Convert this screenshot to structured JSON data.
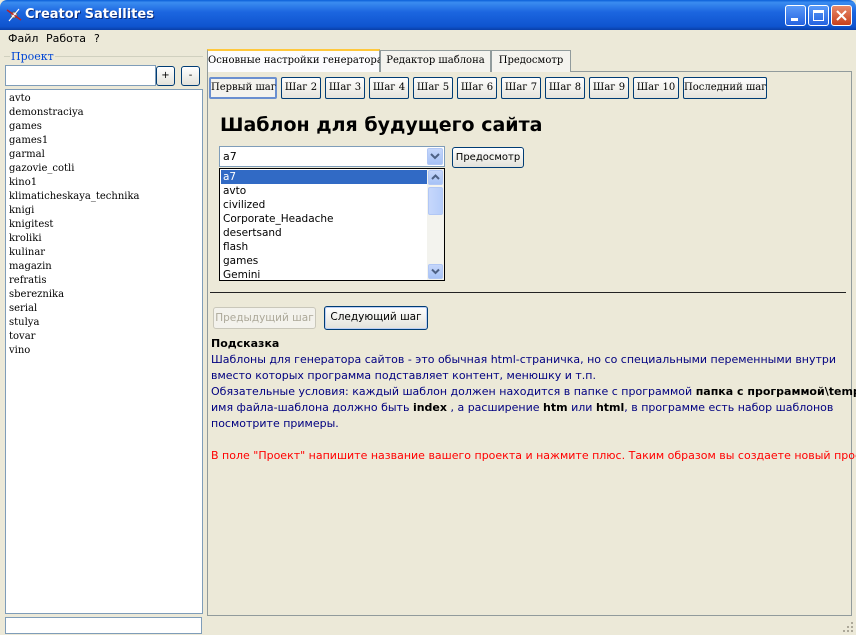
{
  "window": {
    "title": "Creator Satellites"
  },
  "menu": [
    "Файл",
    "Работа",
    "?"
  ],
  "sidebar": {
    "group_label": "Проект",
    "add_label": "+",
    "remove_label": "-",
    "projects": [
      "avto",
      "demonstraciya",
      "games",
      "games1",
      "garmal",
      "gazovie_cotli",
      "kino1",
      "klimaticheskaya_technika",
      "knigi",
      "knigitest",
      "kroliki",
      "kulinar",
      "magazin",
      "refratis",
      "sbereznika",
      "serial",
      "stulya",
      "tovar",
      "vino"
    ]
  },
  "main_tabs": [
    "Основные настройки генератора",
    "Редактор шаблона",
    "Предосмотр"
  ],
  "step_tabs": [
    "Первый шаг",
    "Шаг 2",
    "Шаг 3",
    "Шаг 4",
    "Шаг 5",
    "Шаг 6",
    "Шаг 7",
    "Шаг 8",
    "Шаг 9",
    "Шаг 10",
    "Последний шаг"
  ],
  "content": {
    "heading": "Шаблон  для будущего сайта",
    "template_select_value": "a7",
    "preview_button": "Предосмотр",
    "dropdown_options": [
      "a7",
      "avto",
      "civilized",
      "Corporate_Headache",
      "desertsand",
      "flash",
      "games",
      "Gemini"
    ],
    "prev_button": "Предыдущий шаг",
    "next_button": "Следующий шаг"
  },
  "hint": {
    "title": "Подсказка",
    "line1": "Шаблоны для генератора сайтов - это обычная html-страничка, но со специальными переменными внутри",
    "line2": "вместо которых программа подставляет контент, менюшку и т.п.",
    "line3_pre": "Обязательные условия: каждый шаблон должен находится в папке с программой ",
    "line3_bold": "папка с программой\\templates\\",
    "line4_a": "имя файла-шаблона должно быть ",
    "line4_b": "index",
    "line4_c": " , а расширение ",
    "line4_d": "htm",
    "line4_e": " или  ",
    "line4_f": "html",
    "line4_g": ", в программе есть набор шаблонов",
    "line5": "посмотрите примеры.",
    "red_note": "В поле \"Проект\" напишите название вашего проекта и нажмите плюс. Таким образом вы создаете новый проект."
  }
}
